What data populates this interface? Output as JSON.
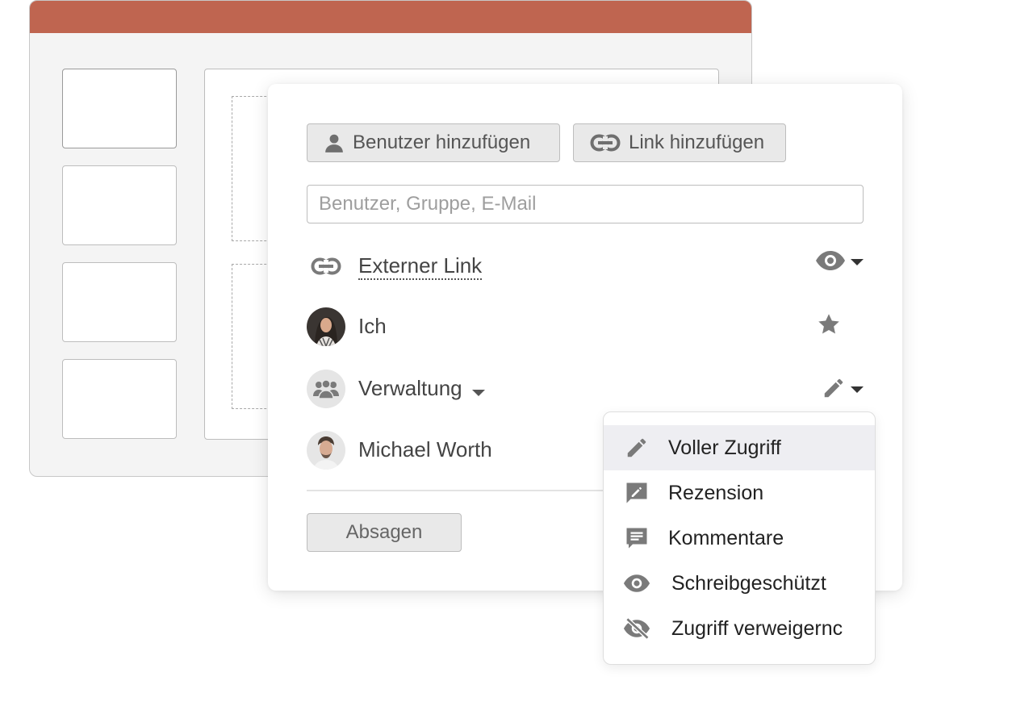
{
  "toolbar": {
    "add_user_label": "Benutzer hinzufügen",
    "add_link_label": "Link hinzufügen"
  },
  "search": {
    "placeholder": "Benutzer, Gruppe, E-Mail"
  },
  "share_list": [
    {
      "name": "Externer Link",
      "type": "link",
      "permission_icon": "eye-icon",
      "has_dropdown": true
    },
    {
      "name": "Ich",
      "type": "user",
      "permission_icon": "star-icon",
      "has_dropdown": false
    },
    {
      "name": "Verwaltung",
      "type": "group",
      "permission_icon": "pencil-icon",
      "has_dropdown": true
    },
    {
      "name": "Michael Worth",
      "type": "user"
    }
  ],
  "footer": {
    "cancel_label": "Absagen"
  },
  "permission_menu": {
    "items": [
      {
        "label": "Voller Zugriff",
        "icon": "pencil-icon",
        "selected": true
      },
      {
        "label": "Rezension",
        "icon": "review-icon",
        "selected": false
      },
      {
        "label": "Kommentare",
        "icon": "comment-icon",
        "selected": false
      },
      {
        "label": "Schreibgeschützt",
        "icon": "eye-icon",
        "selected": false
      },
      {
        "label": "Zugriff verweigernc",
        "icon": "eye-off-icon",
        "selected": false
      }
    ]
  },
  "colors": {
    "titlebar": "#bf6550",
    "icon_gray": "#7a7a7a",
    "selected_bg": "#eeeef2"
  }
}
